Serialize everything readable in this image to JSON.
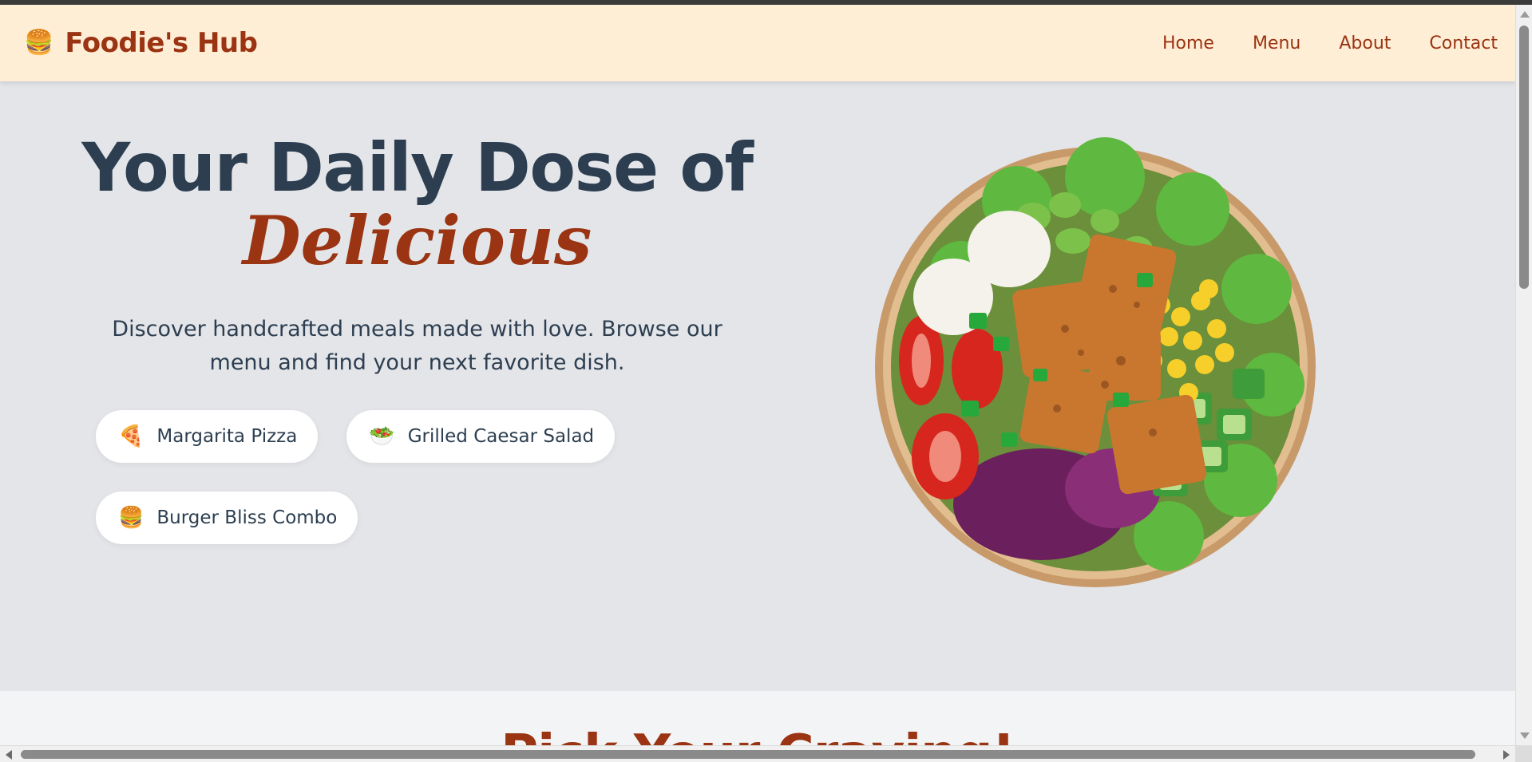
{
  "brand": {
    "icon": "hamburger-icon",
    "emoji": "🍔",
    "name": "Foodie's Hub"
  },
  "nav": {
    "items": [
      "Home",
      "Menu",
      "About",
      "Contact"
    ]
  },
  "hero": {
    "title_line1": "Your Daily Dose of",
    "title_line2": "Delicious",
    "subtitle": "Discover handcrafted meals made with love. Browse our menu and find your next favorite dish.",
    "image": "salad-bowl-image",
    "chips": [
      {
        "icon": "pizza-icon",
        "emoji": "🍕",
        "label": "Margarita Pizza"
      },
      {
        "icon": "salad-icon",
        "emoji": "🥗",
        "label": "Grilled Caesar Salad"
      },
      {
        "icon": "hamburger-icon",
        "emoji": "🍔",
        "label": "Burger Bliss Combo"
      }
    ]
  },
  "section2": {
    "title": "Pick Your Craving!"
  },
  "colors": {
    "accent": "#9a3412",
    "heading": "#2c3e50",
    "navbar_bg": "#ffeed6",
    "hero_bg": "#e4e5e9"
  }
}
